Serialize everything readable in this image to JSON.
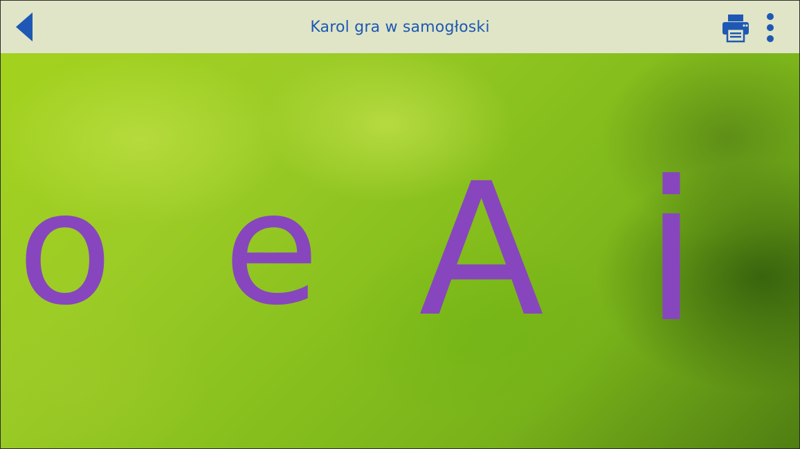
{
  "header": {
    "title": "Karol gra w samogłoski",
    "back_icon": "back-arrow-icon",
    "print_icon": "printer-icon",
    "menu_icon": "overflow-menu-icon"
  },
  "letters": [
    "o",
    "e",
    "A",
    "i"
  ],
  "colors": {
    "header_bg": "#dfe5c6",
    "accent": "#1e58b4",
    "letter": "#8746bd",
    "background": "#9cc820"
  }
}
